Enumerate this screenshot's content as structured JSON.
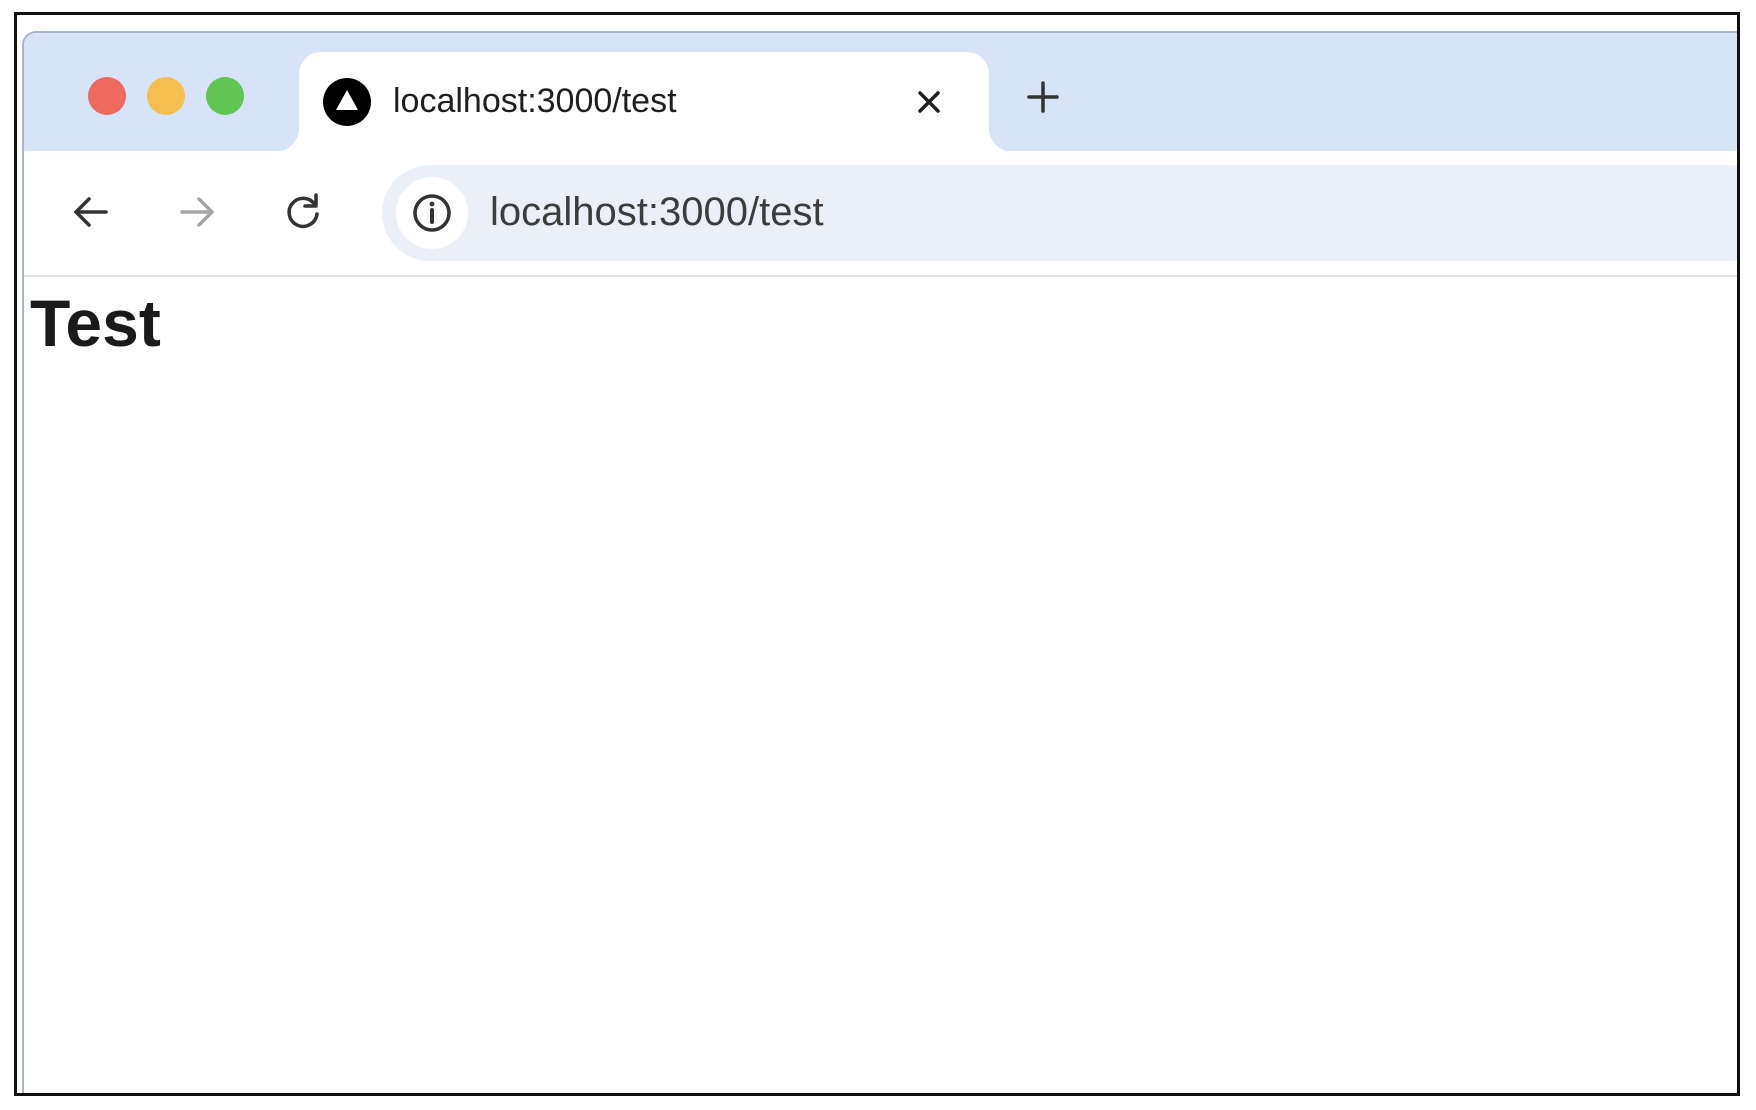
{
  "window": {
    "traffic_lights": {
      "close_color": "#ec6a5e",
      "minimize_color": "#f4bf4f",
      "zoom_color": "#61c554"
    }
  },
  "tabs": [
    {
      "title": "localhost:3000/test",
      "favicon": "nextjs-triangle-icon",
      "active": true,
      "close_icon": "close-icon"
    }
  ],
  "toolbar": {
    "back_icon": "arrow-left-icon",
    "forward_icon": "arrow-right-icon",
    "reload_icon": "reload-icon",
    "new_tab_icon": "plus-icon"
  },
  "omnibox": {
    "site_info_icon": "info-icon",
    "url": "localhost:3000/test"
  },
  "page": {
    "heading": "Test"
  },
  "colors": {
    "tabstrip_bg": "#d7e3f7",
    "omnibox_bg": "#ebf0f8"
  }
}
